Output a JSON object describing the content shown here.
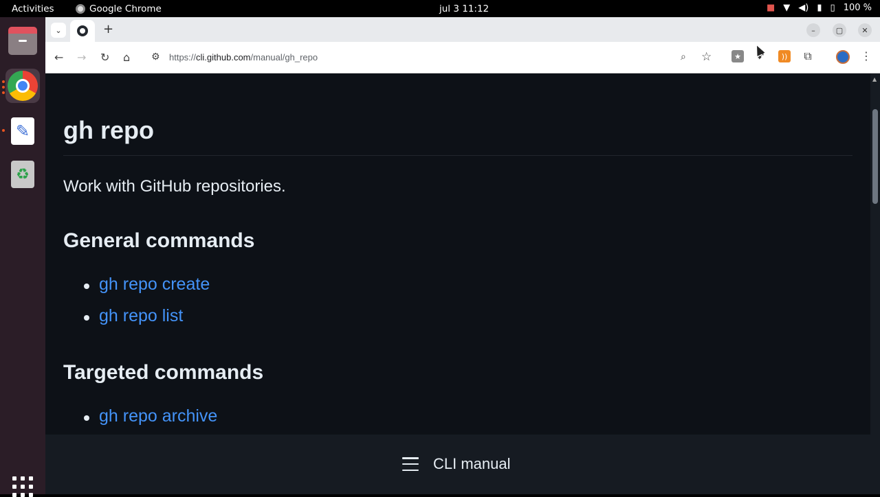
{
  "topbar": {
    "activities": "Activities",
    "app_name": "Google Chrome",
    "clock": "jul 3  11:12",
    "battery": "100 %"
  },
  "dock": {
    "items": [
      "files-icon",
      "chrome-icon",
      "text-editor-icon",
      "trash-icon"
    ],
    "show_apps": "apps-grid-icon"
  },
  "browser": {
    "url_scheme": "https://",
    "url_host": "cli.github.com",
    "url_path": "/manual/gh_repo",
    "accent": "#4493f8"
  },
  "page": {
    "title": "gh repo",
    "description": "Work with GitHub repositories.",
    "general_heading": "General commands",
    "general_commands": [
      "gh repo create",
      "gh repo list"
    ],
    "targeted_heading": "Targeted commands",
    "targeted_commands": [
      "gh repo archive"
    ]
  },
  "bottom": {
    "title": "CLI manual"
  }
}
